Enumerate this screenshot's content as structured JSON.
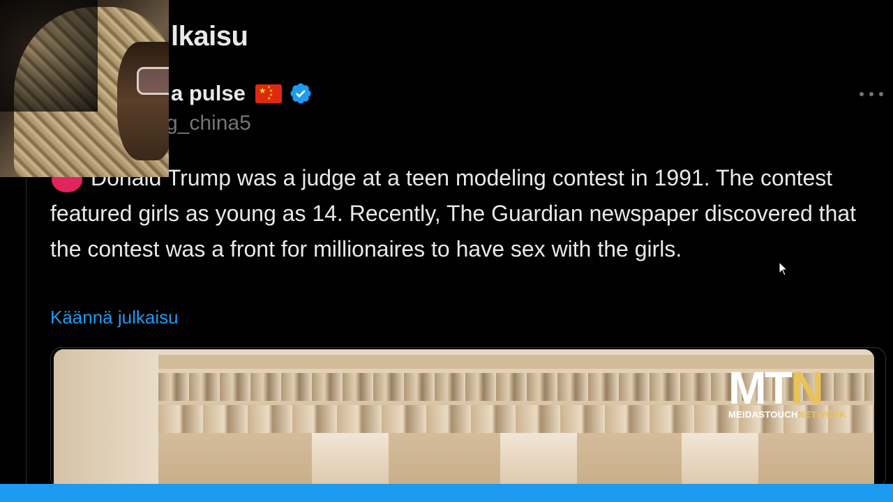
{
  "header": {
    "title": "lkaisu"
  },
  "author": {
    "display_name": "a pulse",
    "handle": "g_china5",
    "flag_icon": "china-flag-icon",
    "verified_icon": "verified-badge-icon"
  },
  "tweet": {
    "text": "Donald Trump was a judge at a teen modeling contest in 1991. The contest featured girls as young as 14. Recently, The Guardian newspaper discovered that the contest was a front for millionaires to have sex with the girls.",
    "translate_label": "Käännä julkaisu"
  },
  "media": {
    "logo_mark_prefix": "MT",
    "logo_mark_suffix": "N",
    "logo_sub_prefix": "MEIDASTOUCH",
    "logo_sub_suffix": "NETWORK"
  },
  "colors": {
    "background": "#000000",
    "text": "#e7e9ea",
    "secondary_text": "#71767b",
    "accent": "#1d9bf0",
    "mtn_gold": "#e8c25b"
  }
}
